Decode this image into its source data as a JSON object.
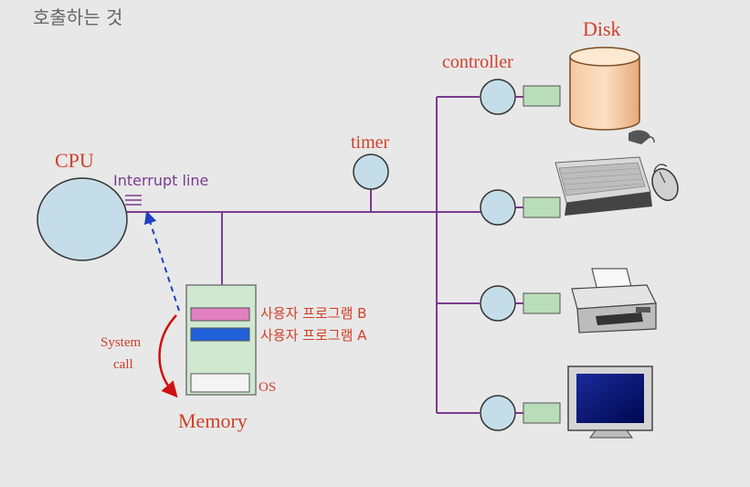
{
  "heading": "호출하는 것",
  "labels": {
    "cpu": "CPU",
    "interrupt_line": "Interrupt line",
    "timer": "timer",
    "controller": "controller",
    "disk": "Disk",
    "memory": "Memory",
    "os": "OS",
    "user_program_b": "사용자 프로그램 B",
    "user_program_a": "사용자 프로그램 A",
    "system_call_1": "System",
    "system_call_2": "call"
  },
  "colors": {
    "bus": "#7a3b8f",
    "node_fill": "#c5dde8",
    "controller_fill": "#b8ddb8",
    "label_red": "#d0402a",
    "label_purple": "#7a3b8f",
    "program_b": "#e080c0",
    "program_a": "#2060d8",
    "system_call_arrow": "#d01010",
    "interrupt_arrow": "#2040c0"
  },
  "devices": [
    "disk",
    "keyboard-and-mouse",
    "printer",
    "monitor"
  ]
}
